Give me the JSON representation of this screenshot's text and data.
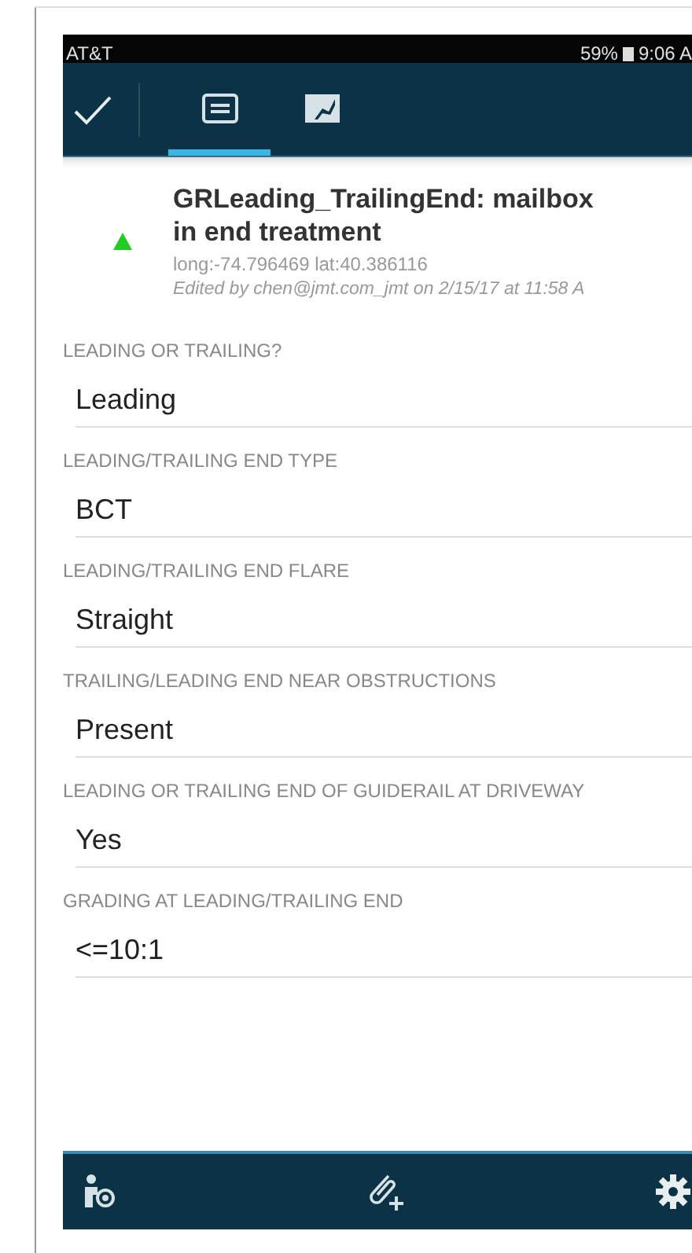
{
  "status_bar": {
    "carrier": "AT&T",
    "battery": "59%",
    "time": "9:06 A"
  },
  "toolbar": {
    "tabs": [
      {
        "kind": "list",
        "selected": true
      },
      {
        "kind": "map",
        "selected": false
      }
    ]
  },
  "feature": {
    "title": "GRLeading_TrailingEnd: mailbox in end treatment",
    "coordinates": "long:-74.796469 lat:40.386116",
    "edited": "Edited by chen@jmt.com_jmt on 2/15/17 at 11:58 A",
    "color": "#22cc22"
  },
  "fields": [
    {
      "label": "LEADING OR TRAILING?",
      "value": "Leading"
    },
    {
      "label": "LEADING/TRAILING END TYPE",
      "value": "BCT"
    },
    {
      "label": "LEADING/TRAILING END FLARE",
      "value": "Straight"
    },
    {
      "label": "TRAILING/LEADING END NEAR OBSTRUCTIONS",
      "value": "Present"
    },
    {
      "label": "LEADING OR TRAILING END OF GUIDERAIL AT DRIVEWAY",
      "value": "Yes"
    },
    {
      "label": "GRADING AT LEADING/TRAILING END",
      "value": "<=10:1"
    }
  ]
}
